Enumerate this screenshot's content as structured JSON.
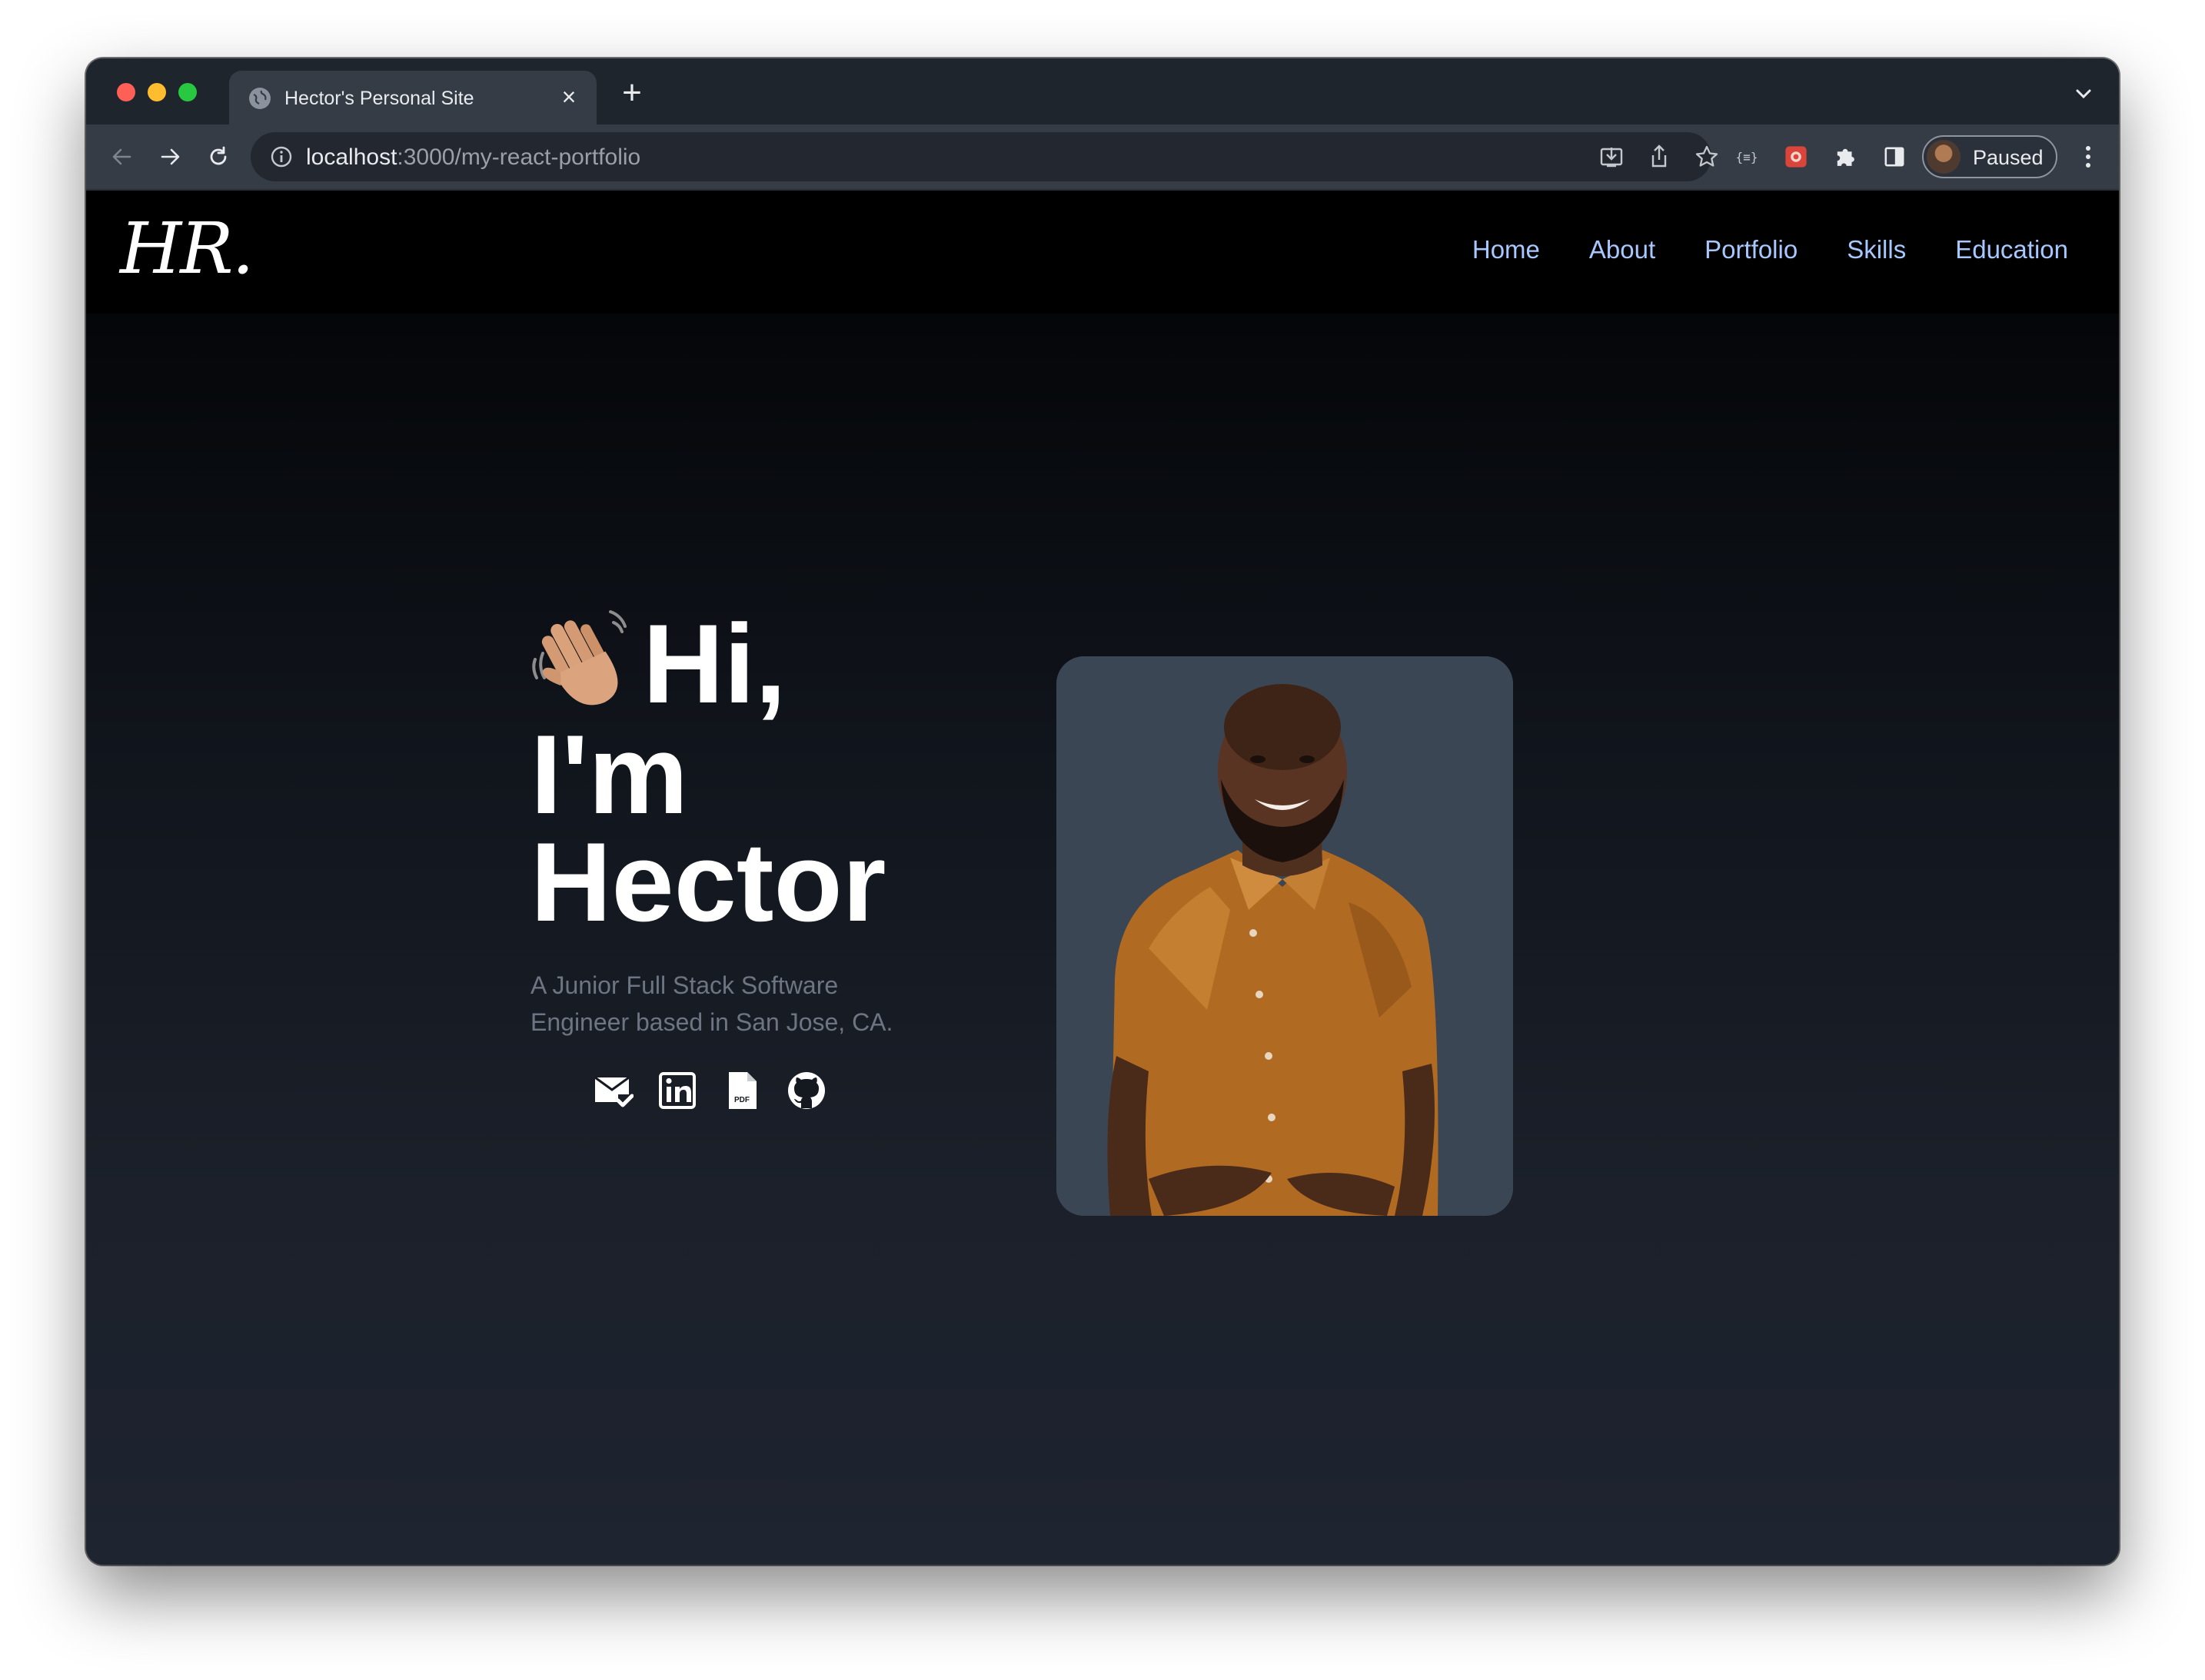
{
  "browser": {
    "tab_title": "Hector's Personal Site",
    "tab_close": "×",
    "new_tab": "+",
    "url_host": "localhost",
    "url_path": ":3000/my-react-portfolio",
    "profile_label": "Paused",
    "extension_label": "{≡}"
  },
  "site": {
    "logo": "HR.",
    "nav": [
      "Home",
      "About",
      "Portfolio",
      "Skills",
      "Education"
    ],
    "hero": {
      "greeting": "Hi,",
      "line2": "I'm",
      "line3": "Hector",
      "tagline": "A Junior Full Stack Software Engineer based in San Jose, CA."
    },
    "socials": [
      {
        "icon": "mail-check-icon"
      },
      {
        "icon": "linkedin-icon"
      },
      {
        "icon": "pdf-resume-icon",
        "label": "PDF"
      },
      {
        "icon": "github-icon"
      }
    ]
  },
  "colors": {
    "nav_link": "#a7c8ff",
    "page_bg_top": "#000000",
    "page_bg_bottom": "#1e2430",
    "portrait_bg": "#3b4655",
    "tagline": "#6e7582"
  }
}
